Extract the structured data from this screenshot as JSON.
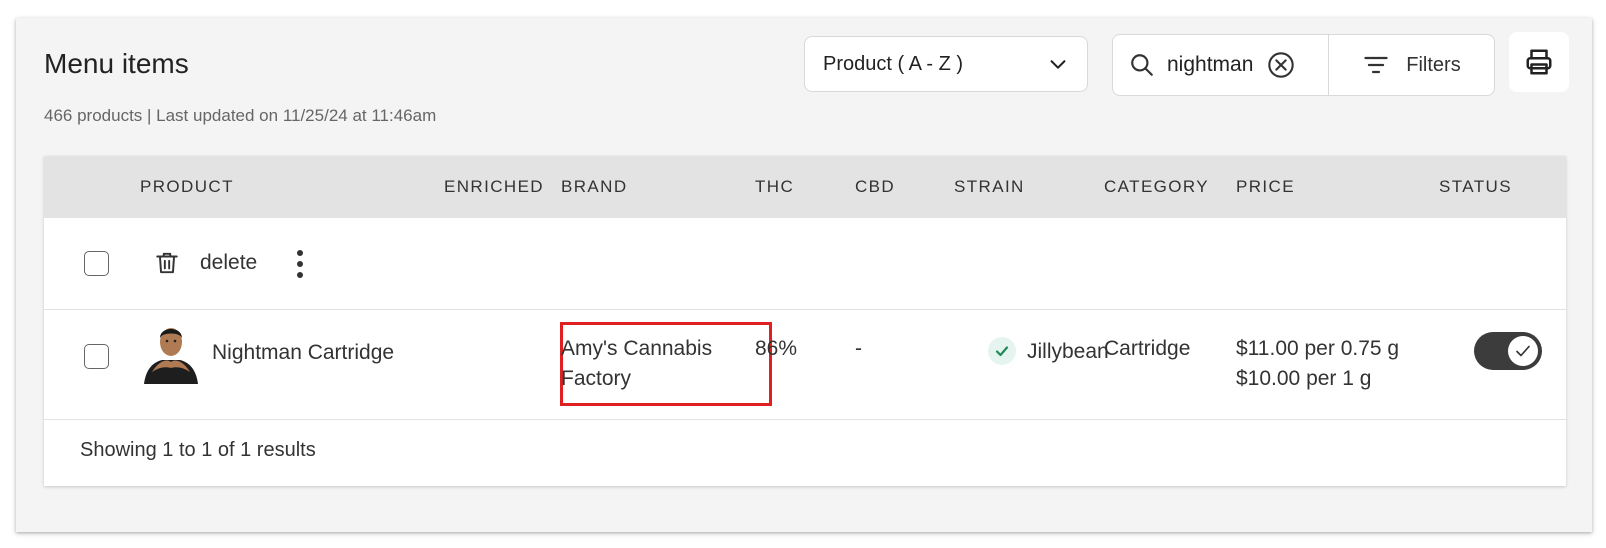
{
  "header": {
    "title": "Menu items",
    "subtitle": "466 products | Last updated on 11/25/24 at 11:46am"
  },
  "toolbar": {
    "sort": {
      "value": "Product ( A - Z )",
      "icon": "chevron-down-icon"
    },
    "search": {
      "value": "nightman",
      "icon": "search-icon",
      "clear_icon": "clear-circle-x-icon"
    },
    "filters": {
      "label": "Filters",
      "icon": "filter-lines-icon"
    },
    "print": {
      "icon": "printer-icon"
    }
  },
  "table": {
    "columns": [
      "PRODUCT",
      "ENRICHED",
      "BRAND",
      "THC",
      "CBD",
      "STRAIN",
      "CATEGORY",
      "PRICE",
      "STATUS"
    ],
    "bulk_actions": {
      "delete_label": "delete",
      "delete_icon": "trash-icon",
      "more_icon": "more-vertical-icon"
    },
    "rows": [
      {
        "product": "Nightman Cartridge",
        "enriched": "",
        "brand_line1": "Amy's Cannabis",
        "brand_line2": "Factory",
        "thc": "86%",
        "cbd": "-",
        "strain": "Jillybean",
        "strain_icon": "check-icon",
        "category": "Cartridge",
        "price_line1": "$11.00 per 0.75 g",
        "price_line2": "$10.00 per 1 g",
        "status_on": true,
        "highlight_color": "#e02020"
      }
    ],
    "footer": "Showing 1 to 1 of 1 results"
  },
  "colors": {
    "panel_bg": "#f4f4f4",
    "header_bg": "#e3e3e3",
    "toggle_on": "#3c3c3c",
    "strain_check": "#1f8a5b",
    "highlight": "#e02020"
  }
}
